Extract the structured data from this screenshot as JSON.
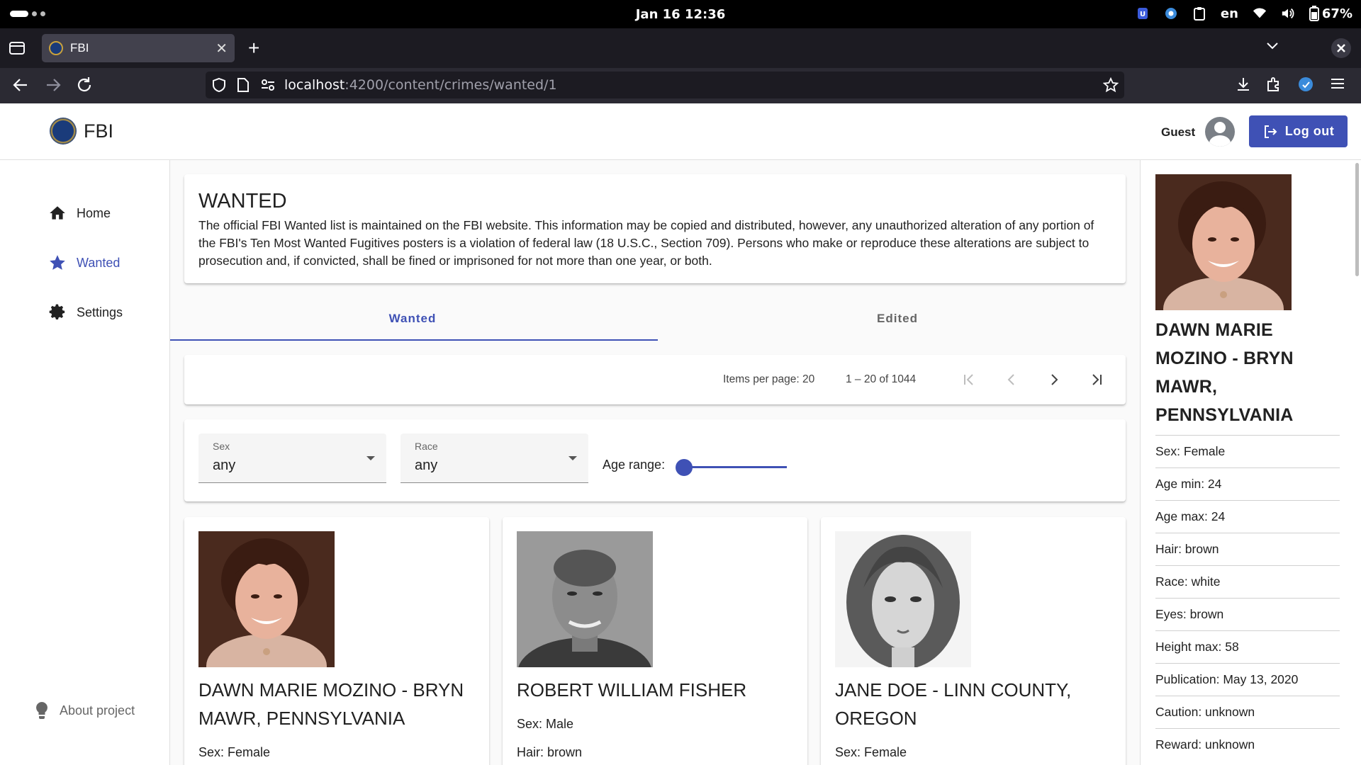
{
  "os": {
    "clock": "Jan 16  12:36",
    "language": "en",
    "battery": "67%"
  },
  "browser": {
    "tab_title": "FBI",
    "tab_close": "✕",
    "new_tab": "+",
    "url_host": "localhost",
    "url_path": ":4200/content/crimes/wanted/1"
  },
  "header": {
    "brand": "FBI",
    "user": "Guest",
    "logout_label": "Log out"
  },
  "sidebar": {
    "items": [
      {
        "label": "Home",
        "icon": "home-icon"
      },
      {
        "label": "Wanted",
        "icon": "star-icon",
        "active": true
      },
      {
        "label": "Settings",
        "icon": "gear-icon"
      }
    ],
    "about": "About project"
  },
  "intro": {
    "title": "WANTED",
    "text": "The official FBI Wanted list is maintained on the FBI website. This information may be copied and distributed, however, any unauthorized alteration of any portion of the FBI's Ten Most Wanted Fugitives posters is a violation of federal law (18 U.S.C., Section 709). Persons who make or reproduce these alterations are subject to prosecution and, if convicted, shall be fined or imprisoned for not more than one year, or both."
  },
  "tabs": [
    {
      "label": "Wanted",
      "active": true
    },
    {
      "label": "Edited",
      "active": false
    }
  ],
  "paginator": {
    "items_per_page": "Items per page: 20",
    "range": "1 – 20 of 1044"
  },
  "filters": {
    "sex": {
      "label": "Sex",
      "value": "any"
    },
    "race": {
      "label": "Race",
      "value": "any"
    },
    "age_label": "Age range:",
    "age_slider_value": 0
  },
  "cards": [
    {
      "name": "DAWN MARIE MOZINO - BRYN MAWR, PENNSYLVANIA",
      "lines": [
        "Sex: Female"
      ]
    },
    {
      "name": "ROBERT WILLIAM FISHER",
      "lines": [
        "Sex: Male",
        "Hair: brown"
      ]
    },
    {
      "name": "JANE DOE - LINN COUNTY, OREGON",
      "lines": [
        "Sex: Female"
      ]
    }
  ],
  "detail": {
    "name": "DAWN MARIE MOZINO - BRYN MAWR, PENNSYLVANIA",
    "rows": [
      "Sex: Female",
      "Age min: 24",
      "Age max: 24",
      "Hair: brown",
      "Race: white",
      "Eyes: brown",
      "Height max: 58",
      "Publication: May 13, 2020",
      "Caution: unknown",
      "Reward: unknown"
    ]
  },
  "colors": {
    "primary": "#3f51b5",
    "os_bar": "#000000",
    "browser_dark": "#2b2a33"
  }
}
